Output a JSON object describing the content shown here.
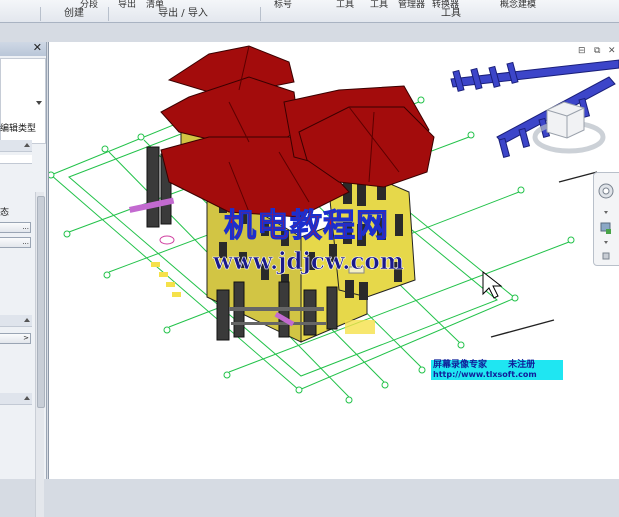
{
  "ribbon": {
    "top_items": [
      {
        "id": "r1",
        "text": "分段"
      },
      {
        "id": "r2",
        "text": "导出"
      },
      {
        "id": "r3",
        "text": "清单"
      },
      {
        "id": "r4",
        "text": "标号"
      },
      {
        "id": "r5",
        "text": "工具"
      },
      {
        "id": "r6",
        "text": "工具"
      },
      {
        "id": "r7",
        "text": "管理器"
      },
      {
        "id": "r8",
        "text": "转换器"
      },
      {
        "id": "r9",
        "text": "概念建模"
      }
    ],
    "groups": {
      "create": "创建",
      "export_import": "导出 / 导入",
      "tools": "工具"
    }
  },
  "properties_panel": {
    "close": "✕",
    "edit_type": "编辑类型",
    "state_fragment": "态",
    "btn_ellipsis_1": "...",
    "btn_ellipsis_2": "...",
    "btn_arrow": ">"
  },
  "viewport": {
    "window_controls": [
      "⊟",
      "⧉",
      "✕"
    ],
    "watermarks": {
      "site_cn": "机电教程网",
      "site_url": "www.jdjcw.com",
      "recorder_name": "屏幕录像专家",
      "recorder_status": "未注册",
      "recorder_url": "http://www.tlxsoft.com"
    },
    "nav_icons": [
      "view-cube-icon",
      "steering-wheel-icon",
      "zoom-icon",
      "orbit-icon"
    ]
  },
  "colors": {
    "roof": "#a30c0c",
    "walls": "#e6d84a",
    "grid": "#23c24a",
    "pipes": "#3c45c9",
    "watermark_red": "#c8141e",
    "watermark_outline": "#1a2fd0",
    "credit_bg": "#1fe6f2"
  }
}
